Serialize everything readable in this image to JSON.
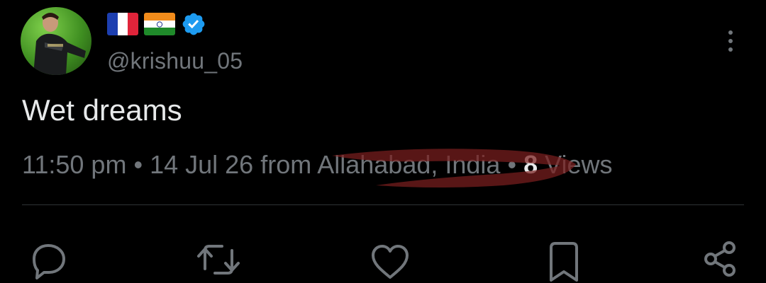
{
  "user": {
    "handle": "@krishuu_05",
    "flags": [
      "france-flag-emoji",
      "india-flag-emoji"
    ],
    "verified": true,
    "verified_color": "#1d9bf0"
  },
  "tweet": {
    "text": "Wet dreams",
    "time": "11:50 pm",
    "date": "14 Jul 26",
    "source_prefix": "from",
    "location": "Allahabad, India",
    "views_count": "8",
    "views_label": "Views",
    "separator": "•"
  },
  "annotation": {
    "type": "red-scribble-over-location",
    "color": "#7a1f1f"
  },
  "actions": [
    "reply-icon",
    "retweet-icon",
    "like-icon",
    "bookmark-icon",
    "share-icon"
  ],
  "colors": {
    "background": "#000000",
    "primary_text": "#e7e9ea",
    "secondary_text": "#71767b",
    "divider": "#2f3336"
  }
}
